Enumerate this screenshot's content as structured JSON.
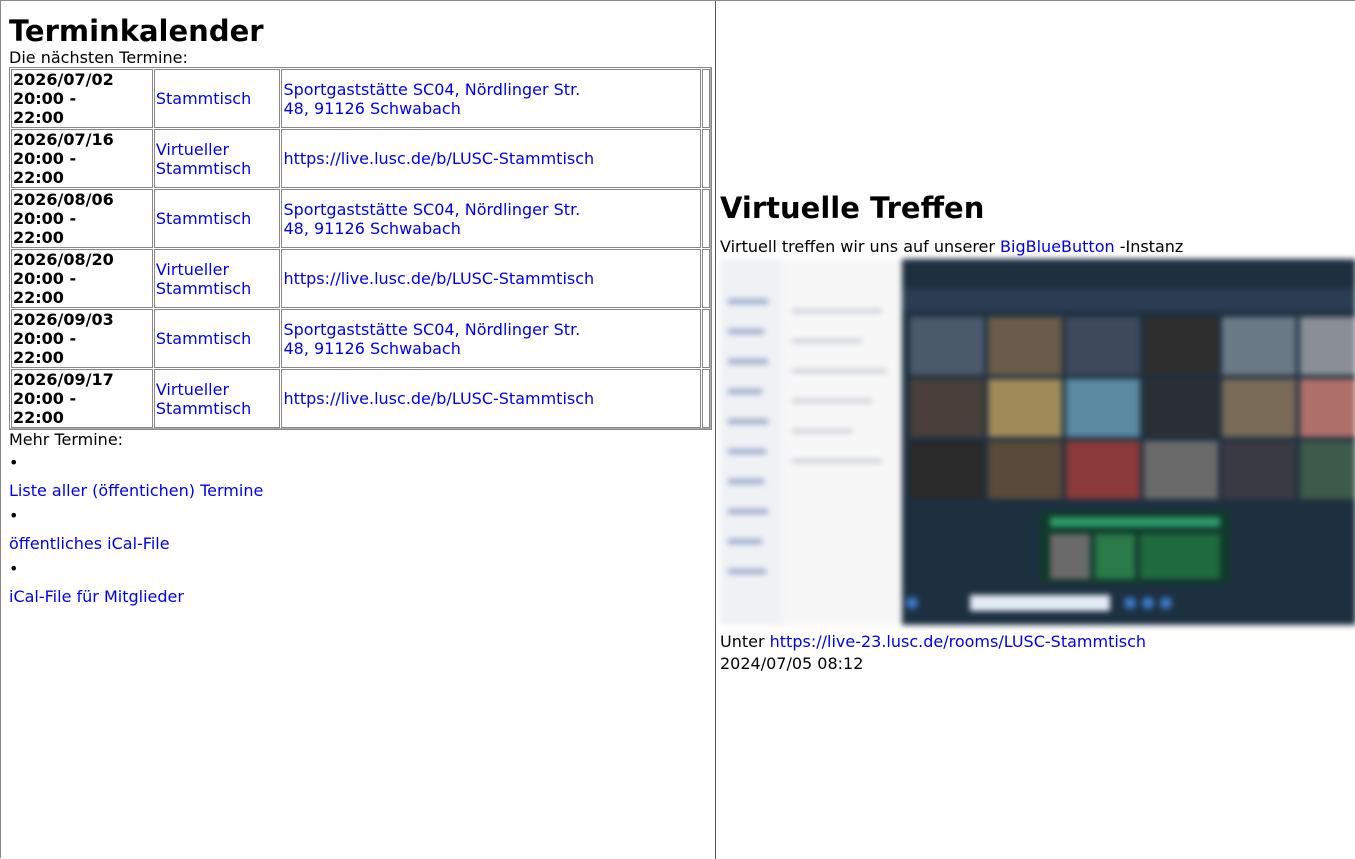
{
  "left": {
    "title": "Terminkalender",
    "intro": "Die nächsten Termine:",
    "events": [
      {
        "date_line1": "2026/07/02",
        "date_line2": "20:00 -",
        "date_line3": "22:00",
        "type_line1": "Stammtisch",
        "type_line2": "",
        "location_line1": "Sportgaststätte SC04, Nördlinger Str.",
        "location_line2": "48, 91126 Schwabach"
      },
      {
        "date_line1": "2026/07/16",
        "date_line2": "20:00 -",
        "date_line3": "22:00",
        "type_line1": "Virtueller",
        "type_line2": "Stammtisch",
        "location_line1": "https://live.lusc.de/b/LUSC-Stammtisch",
        "location_line2": ""
      },
      {
        "date_line1": "2026/08/06",
        "date_line2": "20:00 -",
        "date_line3": "22:00",
        "type_line1": "Stammtisch",
        "type_line2": "",
        "location_line1": "Sportgaststätte SC04, Nördlinger Str.",
        "location_line2": "48, 91126 Schwabach"
      },
      {
        "date_line1": "2026/08/20",
        "date_line2": "20:00 -",
        "date_line3": "22:00",
        "type_line1": "Virtueller",
        "type_line2": "Stammtisch",
        "location_line1": "https://live.lusc.de/b/LUSC-Stammtisch",
        "location_line2": ""
      },
      {
        "date_line1": "2026/09/03",
        "date_line2": "20:00 -",
        "date_line3": "22:00",
        "type_line1": "Stammtisch",
        "type_line2": "",
        "location_line1": "Sportgaststätte SC04, Nördlinger Str.",
        "location_line2": "48, 91126 Schwabach"
      },
      {
        "date_line1": "2026/09/17",
        "date_line2": "20:00 -",
        "date_line3": "22:00",
        "type_line1": "Virtueller",
        "type_line2": "Stammtisch",
        "location_line1": "https://live.lusc.de/b/LUSC-Stammtisch",
        "location_line2": ""
      }
    ],
    "more_label": "Mehr Termine:",
    "bullet": "•",
    "links": [
      {
        "label": "Liste aller (öffentichen) Termine"
      },
      {
        "label": "öffentliches iCal-File"
      },
      {
        "label": "iCal-File für Mitglieder"
      }
    ]
  },
  "right": {
    "title": "Virtuelle Treffen",
    "desc_prefix": "Virtuell treffen wir uns auf unserer ",
    "desc_link": "BigBlueButton",
    "desc_suffix": " -Instanz",
    "unter_prefix": "Unter ",
    "unter_link": "https://live-23.lusc.de/rooms/LUSC-Stammtisch",
    "timestamp": "2024/07/05 08:12"
  },
  "colors": {
    "link": "#0000ee",
    "border": "#888888",
    "screenshot_bg": "#1c2a3a"
  }
}
